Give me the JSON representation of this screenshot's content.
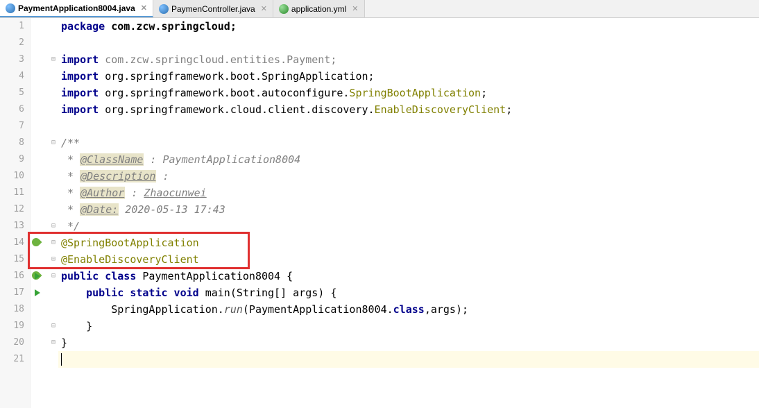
{
  "tabs": [
    {
      "label": "PaymentApplication8004.java",
      "type": "java",
      "active": true
    },
    {
      "label": "PaymenController.java",
      "type": "java",
      "active": false
    },
    {
      "label": "application.yml",
      "type": "yml",
      "active": false
    }
  ],
  "lines": {
    "1": {
      "html": "<span class='kw'>package</span> <span class='pkg'>com.zcw.springcloud;</span>"
    },
    "2": {
      "html": ""
    },
    "3": {
      "html": "<span class='kw'>import</span> <span class='dim'>com.zcw.springcloud.entities.Payment;</span>"
    },
    "4": {
      "html": "<span class='kw'>import</span> org.springframework.boot.SpringApplication;"
    },
    "5": {
      "html": "<span class='kw'>import</span> org.springframework.boot.autoconfigure.<span class='cls'>SpringBootApplication</span>;"
    },
    "6": {
      "html": "<span class='kw'>import</span> org.springframework.cloud.client.discovery.<span class='cls'>EnableDiscoveryClient</span>;"
    },
    "7": {
      "html": ""
    },
    "8": {
      "html": "<span class='dim-it'>/**</span>"
    },
    "9": {
      "html": "<span class='dim-it'> * </span><span class='tag-hl'>@ClassName</span><span class='dim-it'> : PaymentApplication8004</span>"
    },
    "10": {
      "html": "<span class='dim-it'> * </span><span class='tag-hl'>@Description</span><span class='dim-it'> :</span>"
    },
    "11": {
      "html": "<span class='dim-it'> * </span><span class='tag-hl'>@Author</span><span class='dim-it'> : <u>Zhaocunwei</u></span>"
    },
    "12": {
      "html": "<span class='dim-it'> * </span><span class='tag-hl'>@Date:</span><span class='dim-it'> 2020-05-13 17:43</span>"
    },
    "13": {
      "html": "<span class='dim-it'> */</span>"
    },
    "14": {
      "html": "<span class='ann'>@SpringBootApplication</span>"
    },
    "15": {
      "html": "<span class='ann'>@EnableDiscoveryClient</span>"
    },
    "16": {
      "html": "<span class='kw'>public class</span> PaymentApplication8004 {"
    },
    "17": {
      "html": "    <span class='kw'>public static void</span> main(String[] args) {"
    },
    "18": {
      "html": "        SpringApplication.<span class='fn-it'>run</span>(PaymentApplication8004.<span class='kw'>class</span>,args);"
    },
    "19": {
      "html": "    }"
    },
    "20": {
      "html": "}"
    },
    "21": {
      "html": "<span class='caret'></span>"
    }
  },
  "line_count": 21,
  "current_line": 21,
  "highlight_box": {
    "top_line": 14,
    "bottom_line": 15
  },
  "markers": {
    "3": {
      "fold": "⊟"
    },
    "8": {
      "fold": "⊟"
    },
    "13": {
      "fold": "⊟"
    },
    "14": {
      "spring": true,
      "fold": "⊟"
    },
    "15": {
      "fold": "⊟"
    },
    "16": {
      "spring": true,
      "run": true,
      "fold": "⊟"
    },
    "17": {
      "run": true
    },
    "19": {
      "fold": "⊟"
    },
    "20": {
      "fold": "⊟"
    }
  }
}
